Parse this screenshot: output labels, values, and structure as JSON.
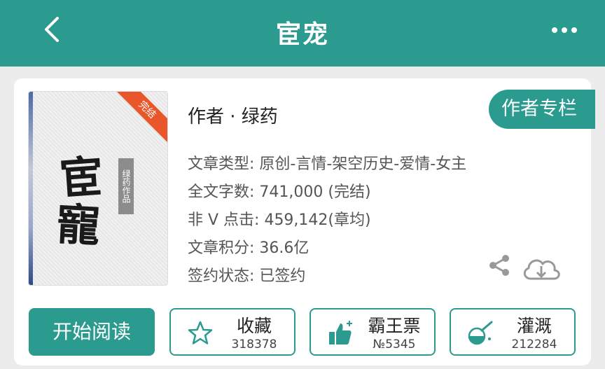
{
  "header": {
    "title": "宦宠",
    "back_icon": "chevron-left-icon",
    "more_icon": "more-horizontal-icon"
  },
  "book": {
    "cover": {
      "calligraphy_top": "宦",
      "calligraphy_bottom": "寵",
      "stamp_text": "绿药作品",
      "ribbon": "完结"
    },
    "author_line": "作者 · 绿药",
    "author_button": "作者专栏",
    "info": [
      "文章类型: 原创-言情-架空历史-爱情-女主",
      "全文字数: 741,000 (完结)",
      "非 V 点击: 459,142(章均)",
      "文章积分: 36.6亿",
      "签约状态: 已签约"
    ]
  },
  "actions": {
    "read_label": "开始阅读",
    "collect": {
      "label": "收藏",
      "count": "318378",
      "icon": "star-icon"
    },
    "ticket": {
      "label": "霸王票",
      "count": "№5345",
      "icon": "thumbs-up-icon"
    },
    "water": {
      "label": "灌溉",
      "count": "212284",
      "icon": "watering-icon"
    }
  },
  "colors": {
    "accent": "#2b9b8f",
    "ribbon": "#e8562a",
    "background": "#ececec"
  }
}
